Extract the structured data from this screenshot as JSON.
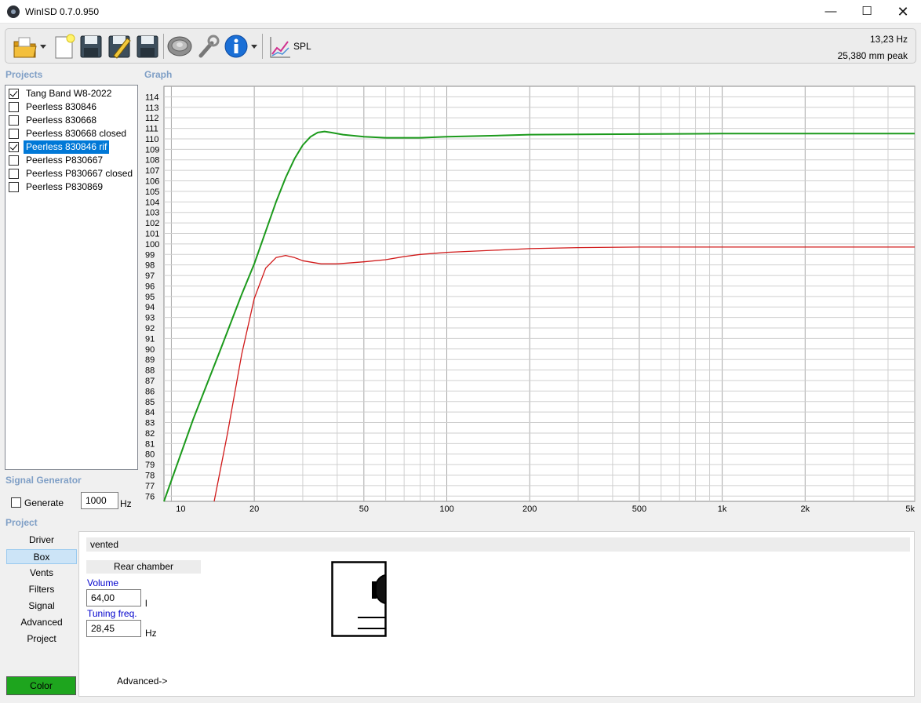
{
  "window": {
    "title": "WinISD 0.7.0.950",
    "minimize": "—",
    "maximize": "☐",
    "close": "✕"
  },
  "toolbar": {
    "icons": [
      "open-folder-icon",
      "new-project-icon",
      "save-icon",
      "save-as-icon",
      "save-all-icon",
      "driver-icon",
      "tools-icon",
      "info-icon",
      "spl-graph-icon"
    ],
    "spl_label": "SPL",
    "readout_freq": "13,23 Hz",
    "readout_excursion": "25,380 mm peak"
  },
  "projects": {
    "label": "Projects",
    "items": [
      {
        "label": "Tang Band W8-2022",
        "checked": true,
        "selected": false
      },
      {
        "label": "Peerless 830846",
        "checked": false,
        "selected": false
      },
      {
        "label": "Peerless 830668",
        "checked": false,
        "selected": false
      },
      {
        "label": "Peerless 830668 closed",
        "checked": false,
        "selected": false
      },
      {
        "label": "Peerless 830846 rif",
        "checked": true,
        "selected": true
      },
      {
        "label": "Peerless P830667",
        "checked": false,
        "selected": false
      },
      {
        "label": "Peerless P830667 closed",
        "checked": false,
        "selected": false
      },
      {
        "label": "Peerless P830869",
        "checked": false,
        "selected": false
      }
    ]
  },
  "signal_generator": {
    "label": "Signal Generator",
    "generate_label": "Generate",
    "generate_checked": false,
    "frequency": "1000",
    "unit": "Hz"
  },
  "graph": {
    "label": "Graph"
  },
  "project": {
    "label": "Project",
    "nav": [
      "Driver",
      "Box",
      "Vents",
      "Filters",
      "Signal",
      "Advanced",
      "Project"
    ],
    "active_nav": "Box",
    "color_button": "Color",
    "color": "#1ea51e"
  },
  "box": {
    "type": "vented",
    "chamber_header": "Rear chamber",
    "volume_label": "Volume",
    "volume_value": "64,00",
    "volume_unit": "l",
    "tuning_label": "Tuning freq.",
    "tuning_value": "28,45",
    "tuning_unit": "Hz",
    "advanced_link": "Advanced->"
  },
  "chart_data": {
    "type": "line",
    "title": "",
    "xlabel": "",
    "ylabel": "",
    "x_scale": "log",
    "xlim": [
      9.4,
      5000
    ],
    "ylim": [
      75.5,
      115
    ],
    "grid": true,
    "x_ticks": [
      10,
      20,
      50,
      100,
      200,
      500,
      1000,
      2000,
      5000
    ],
    "x_tick_labels": [
      "10",
      "20",
      "50",
      "100",
      "200",
      "500",
      "1k",
      "2k",
      "5k"
    ],
    "y_ticks": [
      76,
      77,
      78,
      79,
      80,
      81,
      82,
      83,
      84,
      85,
      86,
      87,
      88,
      89,
      90,
      91,
      92,
      93,
      94,
      95,
      96,
      97,
      98,
      99,
      100,
      101,
      102,
      103,
      104,
      105,
      106,
      107,
      108,
      109,
      110,
      111,
      112,
      113,
      114
    ],
    "series": [
      {
        "color": "#1c9a1c",
        "x": [
          9.4,
          12,
          15,
          18,
          20,
          22,
          24,
          26,
          28,
          30,
          32,
          34,
          36,
          38,
          42,
          50,
          60,
          70,
          80,
          100,
          150,
          200,
          500,
          1000,
          2000,
          5000
        ],
        "y": [
          75.5,
          83.3,
          89.8,
          95.2,
          98.1,
          101.2,
          104.0,
          106.3,
          108.1,
          109.4,
          110.2,
          110.6,
          110.7,
          110.6,
          110.4,
          110.2,
          110.1,
          110.1,
          110.1,
          110.2,
          110.3,
          110.4,
          110.45,
          110.5,
          110.5,
          110.5
        ]
      },
      {
        "color": "#d01818",
        "x": [
          14.3,
          16,
          18,
          20,
          22,
          24,
          26,
          28,
          30,
          35,
          40,
          50,
          60,
          70,
          80,
          100,
          150,
          200,
          300,
          500,
          1000,
          2000,
          5000
        ],
        "y": [
          75.5,
          82.0,
          89.5,
          94.8,
          97.7,
          98.7,
          98.9,
          98.7,
          98.4,
          98.1,
          98.1,
          98.3,
          98.5,
          98.8,
          99.0,
          99.2,
          99.4,
          99.55,
          99.65,
          99.7,
          99.7,
          99.7,
          99.7
        ]
      }
    ]
  }
}
